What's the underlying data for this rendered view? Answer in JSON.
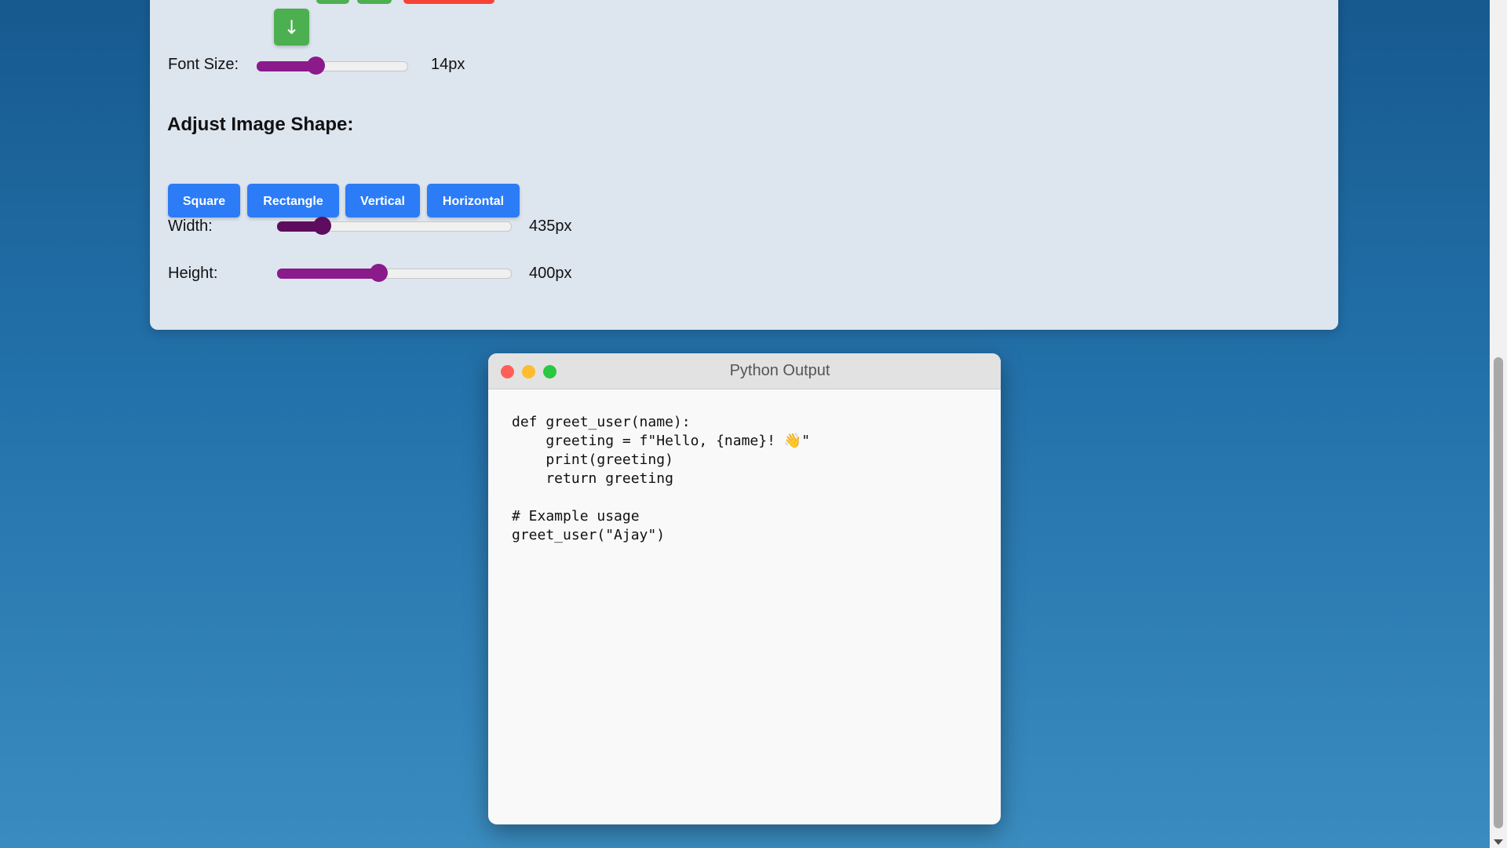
{
  "controls": {
    "down_arrow": "↓",
    "font_size": {
      "label": "Font Size:",
      "value_text": "14px",
      "fraction": 0.39
    },
    "shape_section": {
      "title": "Adjust Image Shape:",
      "buttons": [
        "Square",
        "Rectangle",
        "Vertical",
        "Horizontal"
      ]
    },
    "width": {
      "label": "Width:",
      "value_text": "435px",
      "fraction": 0.19
    },
    "height": {
      "label": "Height:",
      "value_text": "400px",
      "fraction": 0.43
    }
  },
  "python_window": {
    "title": "Python Output",
    "code": "def greet_user(name):\n    greeting = f\"Hello, {name}! 👋\"\n    print(greeting)\n    return greeting\n\n# Example usage\ngreet_user(\"Ajay\")"
  },
  "colors": {
    "slider_purple": "#8b1a8b",
    "slider_dark_purple": "#5e0c5e",
    "button_blue": "#2b7cf6",
    "button_green": "#4caf50",
    "button_red": "#f44336"
  }
}
